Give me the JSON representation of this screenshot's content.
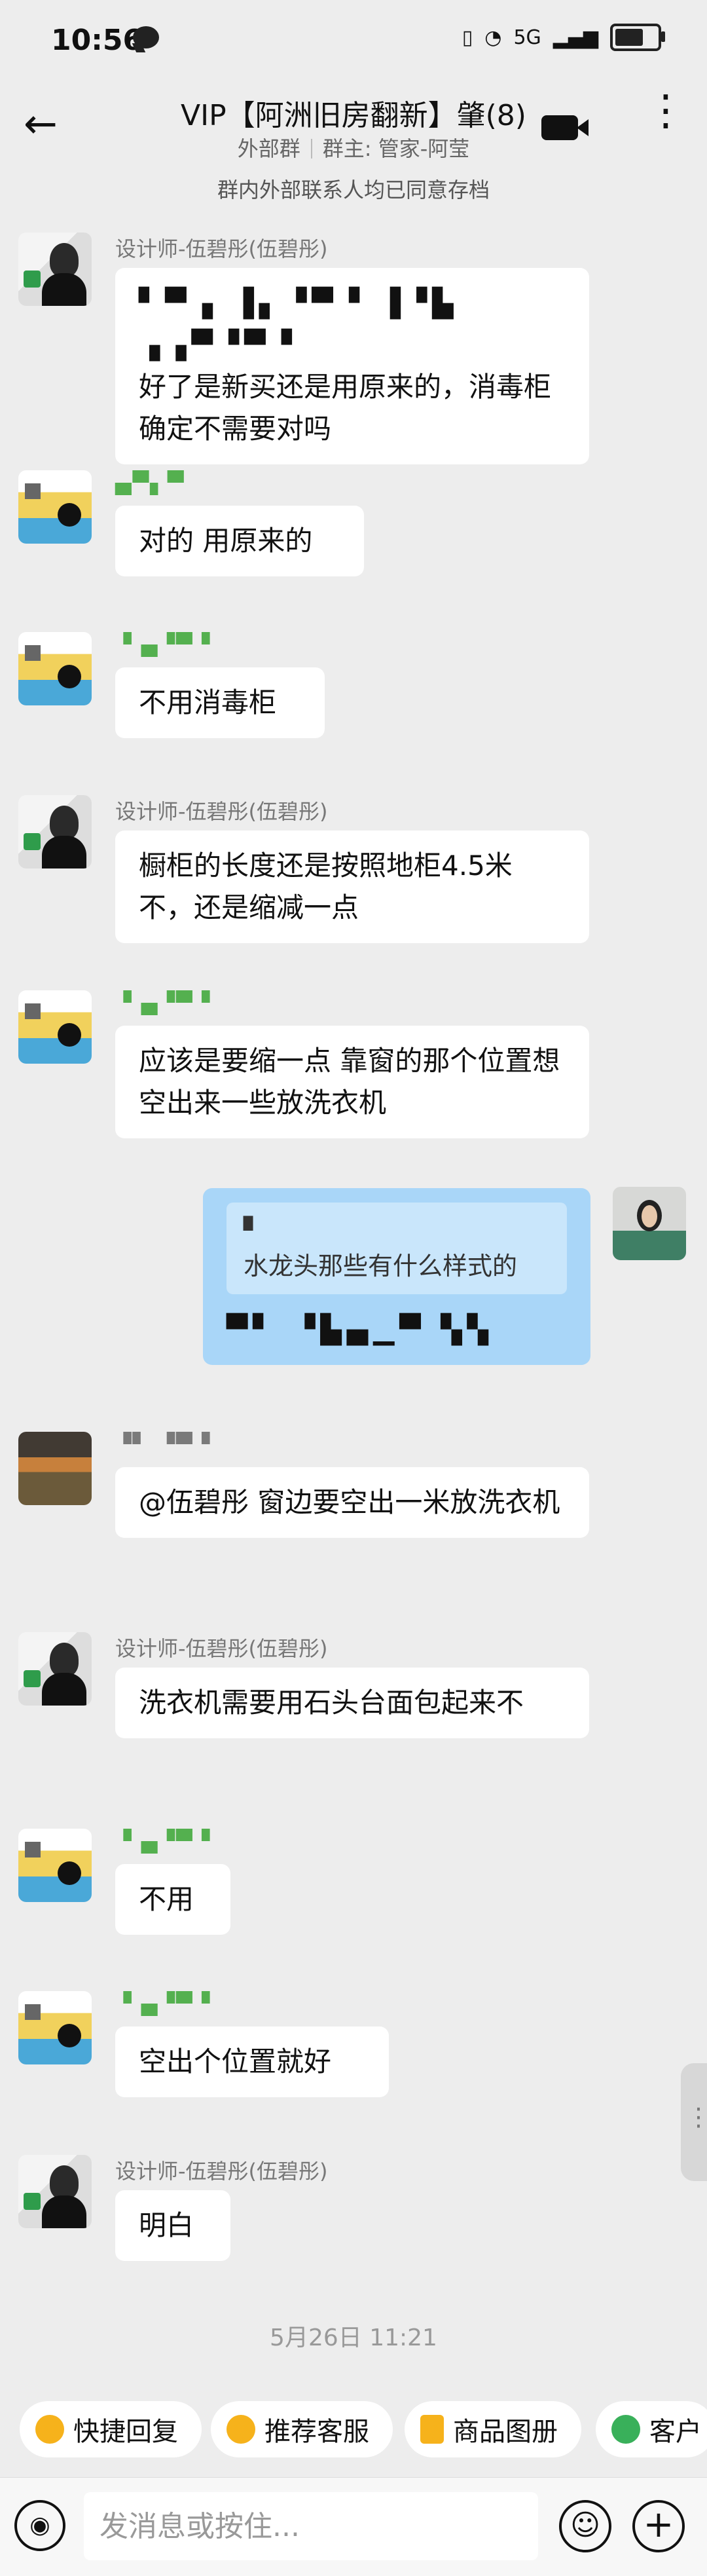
{
  "status_bar": {
    "time": "10:56",
    "signal_text": "5G"
  },
  "header": {
    "title": "VIP【阿洲旧房翻新】肇(8)",
    "subtitle_left": "外部群",
    "subtitle_right": "群主: 管家-阿莹"
  },
  "notice": "群内外部联系人均已同意存档",
  "messages": [
    {
      "sender": "设计师-伍碧彤(伍碧彤)",
      "blur": "▘▀▗ ▐▖▝▀▝ ▐▝▙ ▗▗▀▝▀▝",
      "text": "好了是新买还是用原来的，消毒柜确定不需要对吗"
    },
    {
      "sender": "▄▀▖▀",
      "text": "对的 用原来的"
    },
    {
      "sender": "▝ ▄▝▀▝",
      "text": "不用消毒柜"
    },
    {
      "sender": "设计师-伍碧彤(伍碧彤)",
      "text": "橱柜的长度还是按照地柜4.5米不，还是缩减一点"
    },
    {
      "sender": "▝ ▄▝▀▝",
      "text": "应该是要缩一点 靠窗的那个位置想空出来一些放洗衣机"
    },
    {
      "quote_name": "▘",
      "quote_text": "水龙头那些有什么样式的",
      "blur": "▀▘ ▝▙▄▁▀ ▚▚"
    },
    {
      "sender": "▝▘ ▝▀▝",
      "text": "@伍碧彤 窗边要空出一米放洗衣机"
    },
    {
      "sender": "设计师-伍碧彤(伍碧彤)",
      "text": "洗衣机需要用石头台面包起来不"
    },
    {
      "sender": "▝ ▄▝▀▝",
      "text": "不用"
    },
    {
      "sender": "▝ ▄▝▀▝",
      "text": "空出个位置就好"
    },
    {
      "sender": "设计师-伍碧彤(伍碧彤)",
      "text": "明白"
    }
  ],
  "timestamp": "5月26日  11:21",
  "quick_actions": [
    "快捷回复",
    "推荐客服",
    "商品图册",
    "客户"
  ],
  "input": {
    "placeholder": "发消息或按住..."
  }
}
